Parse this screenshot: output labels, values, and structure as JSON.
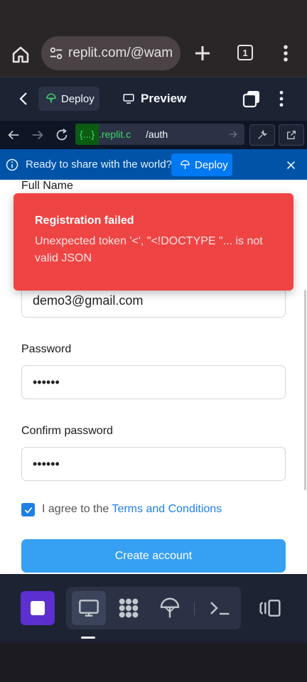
{
  "browser": {
    "url": "replit.com/@wam",
    "tab_count": "1"
  },
  "replit_header": {
    "deploy_label": "Deploy",
    "preview_label": "Preview"
  },
  "address_bar": {
    "dev_prefix": "{...}",
    "domain": ".replit.c",
    "path": "/auth"
  },
  "banner": {
    "message": "Ready to share with the world?",
    "deploy_label": "Deploy"
  },
  "form": {
    "full_name_label": "Full Name",
    "email_value": "demo3@gmail.com",
    "password_label": "Password",
    "password_value": "••••••",
    "confirm_label": "Confirm password",
    "confirm_value": "••••••",
    "agree_text": "I agree to the ",
    "terms_link": "Terms and Conditions",
    "terms_checked": true,
    "create_button": "Create account"
  },
  "toast": {
    "title": "Registration failed",
    "description": "Unexpected token '<', \"<!DOCTYPE \"... is not valid JSON"
  },
  "icons": {
    "home": "home-icon",
    "tune": "site-settings-icon",
    "plus": "plus-icon",
    "tabs": "tab-switcher-icon",
    "menu": "kebab-menu-icon",
    "back": "chevron-left-icon",
    "deploy": "deploy-icon",
    "preview": "monitor-icon",
    "windows": "windows-icon",
    "nav_back": "arrow-left-icon",
    "nav_forward": "arrow-right-icon",
    "reload": "reload-icon",
    "devtools": "wrench-icon",
    "open_new": "open-external-icon",
    "info": "info-icon",
    "close": "close-icon",
    "check": "check-icon",
    "agent": "agent-icon",
    "webview": "monitor-icon",
    "workspace": "grid-icon",
    "deployments": "deploy-icon",
    "shell": "terminal-icon",
    "layout": "layout-icon"
  },
  "colors": {
    "toast_bg": "#ef4444",
    "primary_button": "#36a0f3",
    "banner_bg": "#0053a6",
    "link": "#1f7fe8"
  }
}
